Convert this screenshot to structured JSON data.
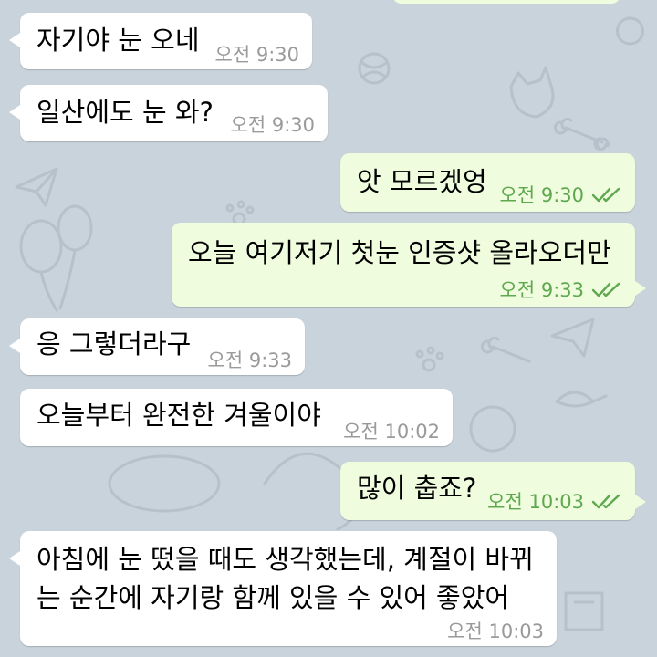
{
  "colors": {
    "background": "#c9d3db",
    "incoming_bubble": "#ffffff",
    "outgoing_bubble": "#effdde",
    "incoming_time": "#9a9a9a",
    "outgoing_time": "#5fa84f"
  },
  "messages": [
    {
      "direction": "incoming",
      "text": "자기야 눈 오네",
      "time": "오전 9:30"
    },
    {
      "direction": "incoming",
      "text": "일산에도 눈 와?",
      "time": "오전 9:30"
    },
    {
      "direction": "outgoing",
      "text": "앗 모르겠엉",
      "time": "오전 9:30",
      "status": "read-double-check-icon"
    },
    {
      "direction": "outgoing",
      "text": "오늘 여기저기 첫눈 인증샷 올라오더만",
      "time": "오전 9:33",
      "status": "read-double-check-icon"
    },
    {
      "direction": "incoming",
      "text": "응 그렇더라구",
      "time": "오전 9:33"
    },
    {
      "direction": "incoming",
      "text": "오늘부터 완전한 겨울이야",
      "time": "오전 10:02"
    },
    {
      "direction": "outgoing",
      "text": "많이 춥죠?",
      "time": "오전 10:03",
      "status": "read-double-check-icon"
    },
    {
      "direction": "incoming",
      "lines": [
        "아침에 눈 떴을 때도 생각했는데, 계절이 바뀌",
        "는 순간에 자기랑 함께 있을 수 있어 좋았어"
      ],
      "time": "오전 10:03"
    }
  ]
}
